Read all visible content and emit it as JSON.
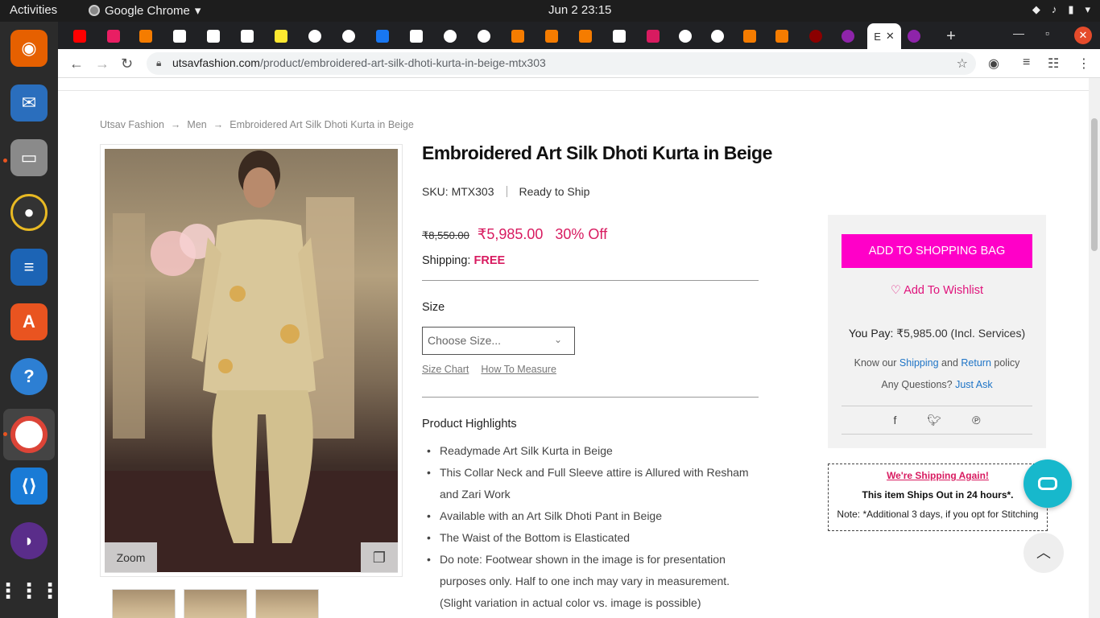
{
  "system": {
    "activities": "Activities",
    "app_name": "Google Chrome",
    "clock": "Jun 2  23:15"
  },
  "browser": {
    "active_tab_label": "E",
    "url_host": "utsavfashion.com",
    "url_path": "/product/embroidered-art-silk-dhoti-kurta-in-beige-mtx303"
  },
  "breadcrumb": {
    "items": [
      "Utsav Fashion",
      "Men",
      "Embroidered Art Silk Dhoti Kurta in Beige"
    ],
    "separator": "→"
  },
  "product": {
    "title": "Embroidered Art Silk Dhoti Kurta in Beige",
    "sku_label": "SKU:",
    "sku": "MTX303",
    "status": "Ready to Ship",
    "old_price": "₹8,550.00",
    "price": "₹5,985.00",
    "discount": "30% Off",
    "shipping_label": "Shipping:",
    "shipping_value": "FREE",
    "size_label": "Size",
    "size_placeholder": "Choose Size...",
    "size_chart": "Size Chart",
    "how_to_measure": "How To Measure",
    "highlights_title": "Product Highlights",
    "highlights": [
      "Readymade Art Silk Kurta in Beige",
      "This Collar Neck and Full Sleeve attire is Allured with Resham and Zari Work",
      "Available with an Art Silk Dhoti Pant in Beige",
      "The Waist of the Bottom is Elasticated",
      "Do note: Footwear shown in the image is for presentation purposes only. Half to one inch may vary in measurement. (Slight variation in actual color vs. image is possible)"
    ]
  },
  "gallery": {
    "zoom_label": "Zoom"
  },
  "buybox": {
    "add_to_bag": "ADD TO SHOPPING BAG",
    "wishlist": "Add To Wishlist",
    "you_pay_label": "You Pay:",
    "you_pay_value": "₹5,985.00 (Incl. Services)",
    "know_our": "Know our",
    "shipping_link": "Shipping",
    "and": "and",
    "return_link": "Return",
    "policy": "policy",
    "questions": "Any Questions?",
    "just_ask": "Just Ask"
  },
  "shipping_notice": {
    "headline": "We're Shipping Again!",
    "line2": "This item Ships Out in 24 hours*.",
    "line3": "Note: *Additional 3 days, if you opt for Stitching"
  },
  "colors": {
    "accent_pink": "#ff00c8",
    "price_red": "#d81b60",
    "link_blue": "#1e74c6",
    "chat_teal": "#17b8cc"
  }
}
